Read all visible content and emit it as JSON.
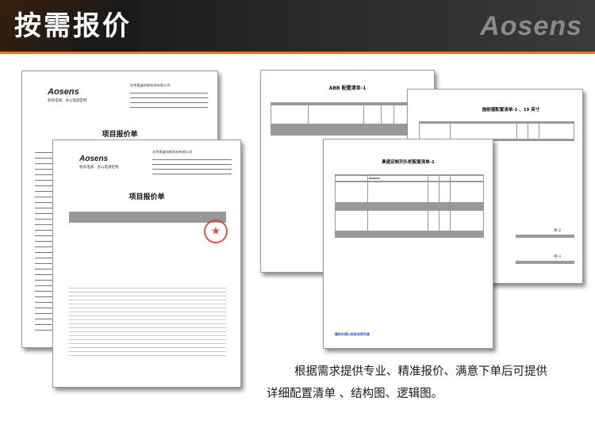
{
  "banner": {
    "title": "按需报价",
    "brand": "Aosens"
  },
  "quote_sheet": {
    "logo": "Aosens",
    "slogan": "机房电源、办公电源定制",
    "company_name": "北京奥盛创新科技有限公司",
    "title": "项目报价单"
  },
  "config_sheet": {
    "title": "ABB 配置清单-1"
  },
  "config_sheet_2": {
    "title": "施耐德配置清单-1 、19 英寸",
    "section_2": "单-2",
    "section_3": "单-3"
  },
  "custom_sheet": {
    "title": "奥盛定制列头柜配置清单-1",
    "brand_cell": "Aosens",
    "footer_note": "最终价格以实际合同为准"
  },
  "caption": {
    "line1": "根据需求提供专业、精准报价、满意下单后可提供",
    "line2": "详细配置清单 、结构图、逻辑图。"
  },
  "colors": {
    "accent": "#e8731c",
    "stamp": "#d9342b",
    "banner": "#141414"
  }
}
